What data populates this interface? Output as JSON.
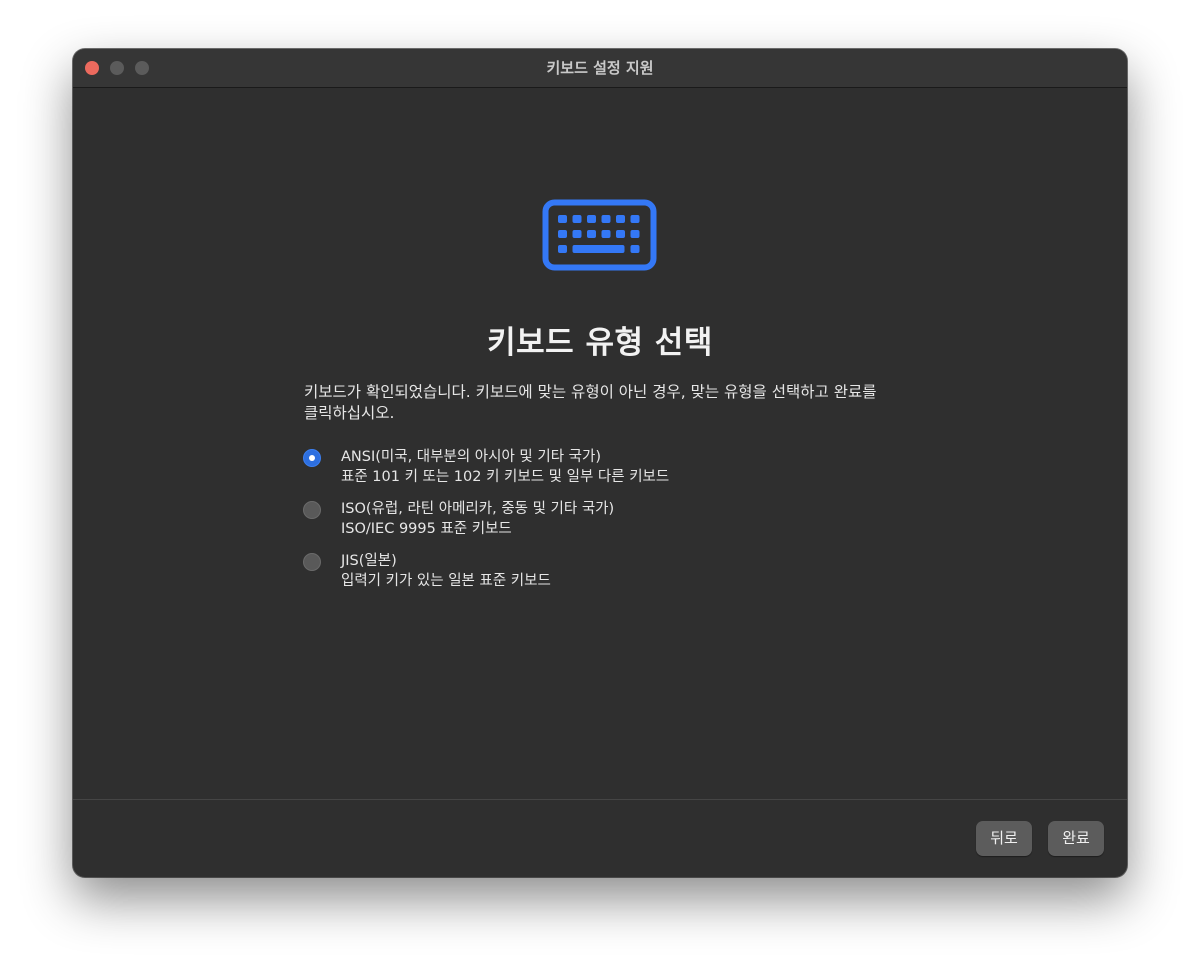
{
  "window": {
    "title": "키보드 설정 지원"
  },
  "icon": {
    "name": "keyboard-icon",
    "color": "#3478f6"
  },
  "main": {
    "heading": "키보드 유형 선택",
    "description_line1": "키보드가 확인되었습니다. 키보드에 맞는 유형이 아닌 경우, 맞는 유형을 선택하고 완료를",
    "description_line2": "클릭하십시오."
  },
  "options": [
    {
      "title": "ANSI(미국, 대부분의 아시아 및 기타 국가)",
      "subtitle": "표준 101 키 또는 102 키 키보드 및 일부 다른 키보드",
      "selected": true
    },
    {
      "title": "ISO(유럽, 라틴 아메리카, 중동 및 기타 국가)",
      "subtitle": "ISO/IEC 9995 표준 키보드",
      "selected": false
    },
    {
      "title": "JIS(일본)",
      "subtitle": "입력기 키가 있는 일본 표준 키보드",
      "selected": false
    }
  ],
  "footer": {
    "back_label": "뒤로",
    "done_label": "완료"
  },
  "colors": {
    "close": "#ec6a5e",
    "accent": "#2d6fe0"
  }
}
